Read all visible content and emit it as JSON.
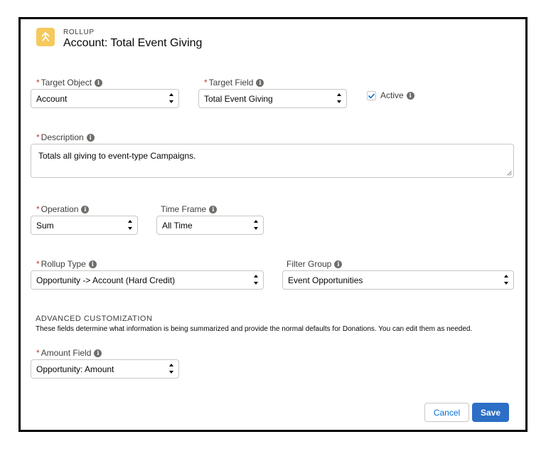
{
  "header": {
    "eyebrow": "ROLLUP",
    "title": "Account: Total Event Giving",
    "icon": "rollup-arrow-icon",
    "icon_color": "#f5c95c"
  },
  "fields": {
    "target_object": {
      "label": "Target Object",
      "required": "*",
      "value": "Account"
    },
    "target_field": {
      "label": "Target Field",
      "required": "*",
      "value": "Total Event Giving"
    },
    "active": {
      "label": "Active",
      "checked": true
    },
    "description": {
      "label": "Description",
      "required": "*",
      "value": "Totals all giving to event-type Campaigns."
    },
    "operation": {
      "label": "Operation",
      "required": "*",
      "value": "Sum"
    },
    "time_frame": {
      "label": "Time Frame",
      "value": "All Time"
    },
    "rollup_type": {
      "label": "Rollup Type",
      "required": "*",
      "value": "Opportunity -> Account (Hard Credit)"
    },
    "filter_group": {
      "label": "Filter Group",
      "value": "Event Opportunities"
    },
    "amount_field": {
      "label": "Amount Field",
      "required": "*",
      "value": "Opportunity: Amount"
    }
  },
  "advanced": {
    "heading": "ADVANCED CUSTOMIZATION",
    "description": "These fields determine what information is being summarized and provide the normal defaults for Donations. You can edit them as needed."
  },
  "actions": {
    "cancel_label": "Cancel",
    "save_label": "Save",
    "save_color": "#2d6fc6"
  }
}
